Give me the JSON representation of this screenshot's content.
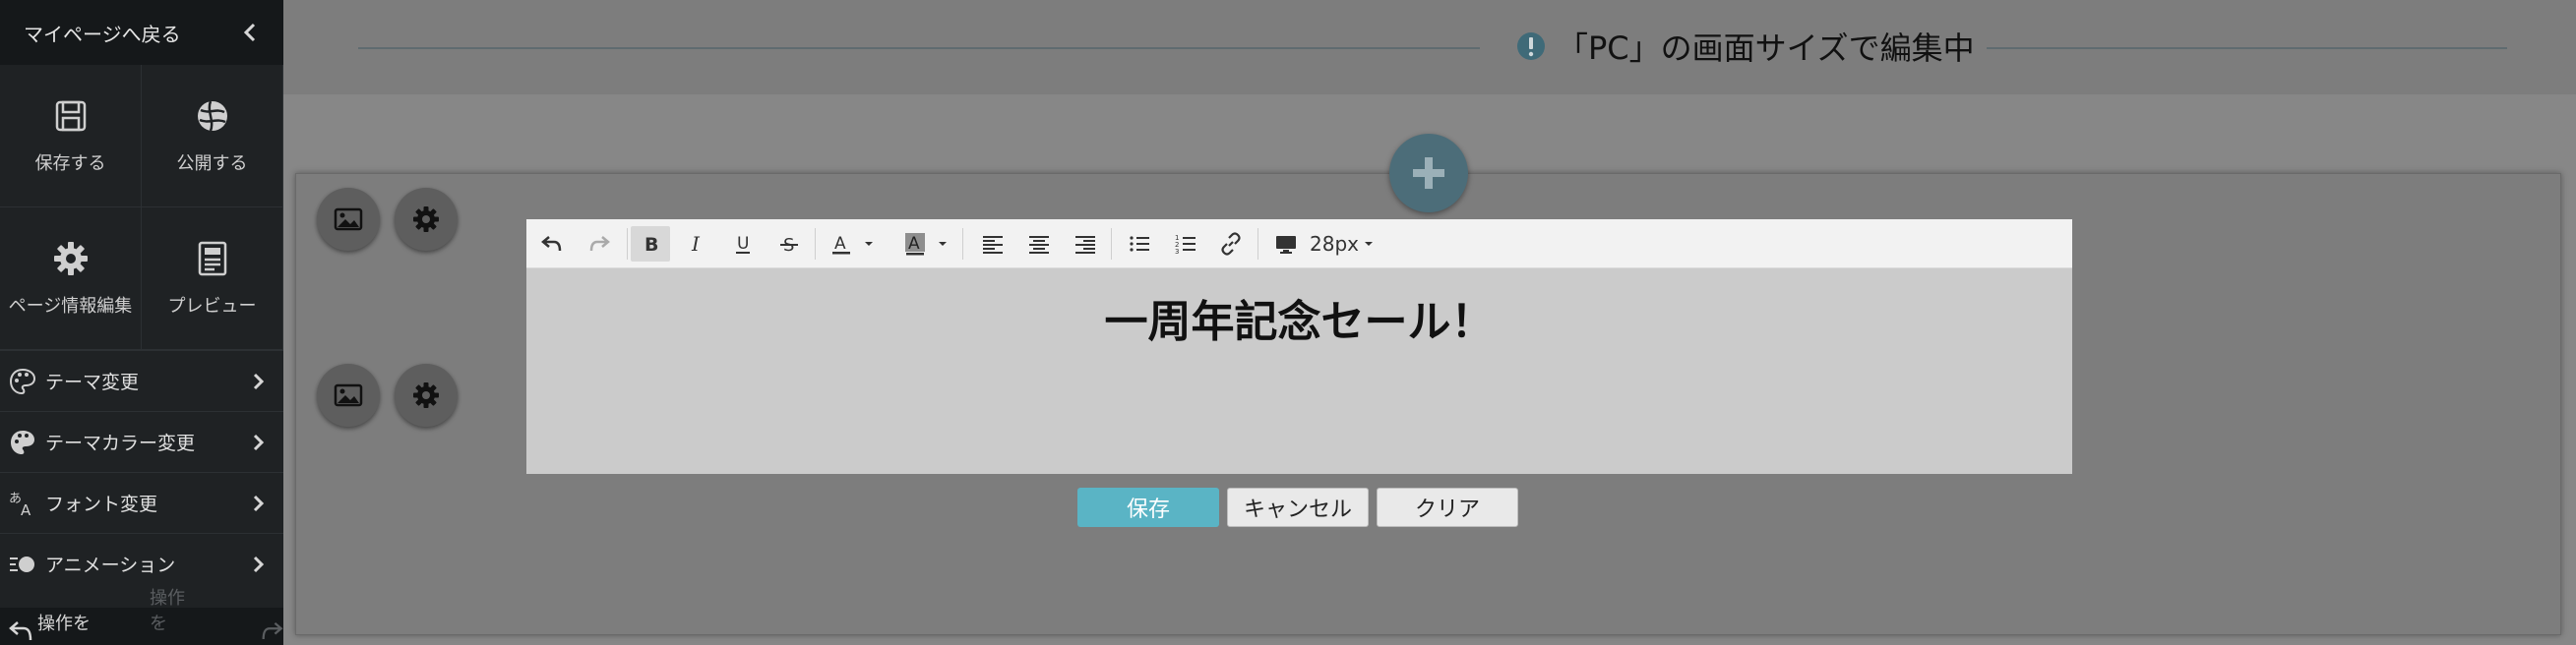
{
  "sidebar": {
    "back_label": "マイページへ戻る",
    "grid": [
      {
        "label": "保存する",
        "icon": "save-icon"
      },
      {
        "label": "公開する",
        "icon": "publish-icon"
      },
      {
        "label": "ページ情報編集",
        "icon": "gear-icon"
      },
      {
        "label": "プレビュー",
        "icon": "preview-icon"
      }
    ],
    "menu": [
      {
        "label": "テーマ変更",
        "icon": "palette-icon"
      },
      {
        "label": "テーマカラー変更",
        "icon": "palette-icon"
      },
      {
        "label": "フォント変更",
        "icon": "font-icon"
      },
      {
        "label": "アニメーション",
        "icon": "animation-icon"
      }
    ],
    "undo_label": "操作を",
    "redo_label": "操作を"
  },
  "banner": {
    "title": "「PC」の画面サイズで編集中"
  },
  "editor": {
    "font_size": "28px",
    "content": "一周年記念セール！"
  },
  "actions": {
    "save": "保存",
    "cancel": "キャンセル",
    "clear": "クリア"
  },
  "colors": {
    "sidebar_bg": "#1f2224",
    "accent": "#5ab4c5",
    "info": "#4c6d79"
  }
}
